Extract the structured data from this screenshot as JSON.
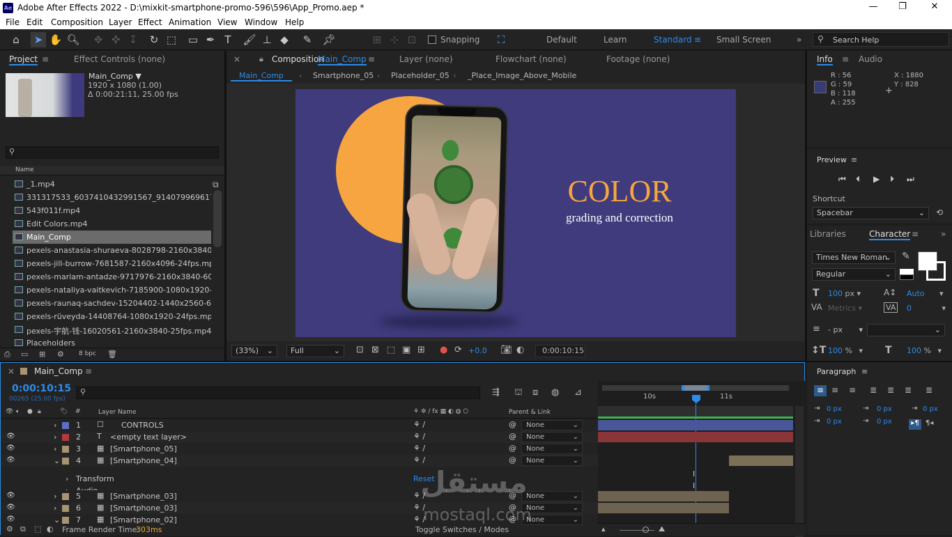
{
  "window": {
    "title": "Adobe After Effects 2022 - D:\\mixkit-smartphone-promo-596\\596\\App_Promo.aep *",
    "app_icon": "Ae"
  },
  "menu": [
    "File",
    "Edit",
    "Composition",
    "Layer",
    "Effect",
    "Animation",
    "View",
    "Window",
    "Help"
  ],
  "toolbar": {
    "snapping": "Snapping",
    "workspaces": [
      "Default",
      "Learn",
      "Standard",
      "Small Screen"
    ],
    "active_workspace": "Standard",
    "search_help": "Search Help",
    "more": "»"
  },
  "project": {
    "tab": "Project",
    "effect_controls": "Effect Controls (none)",
    "comp_name": "Main_Comp ▼",
    "comp_size": "1920 x 1080 (1.00)",
    "comp_duration": "Δ 0:00:21:11, 25.00 fps",
    "col_name": "Name",
    "items": [
      "_1.mp4",
      "331317533_6037410432991567_91407996961760752",
      "543f011f.mp4",
      "Edit Colors.mp4",
      "Main_Comp",
      "pexels-anastasia-shuraeva-8028798-2160x3840-24fps",
      "pexels-jill-burrow-7681587-2160x4096-24fps.mp4",
      "pexels-mariam-antadze-9717976-2160x3840-60fps.mp",
      "pexels-nataliya-vaitkevich-7185900-1080x1920-30fps.",
      "pexels-raunaq-sachdev-15204402-1440x2560-60fps.m",
      "pexels-rüveyda-14408764-1080x1920-24fps.mp4",
      "pexels-宇航-钱-16020561-2160x3840-25fps.mp4",
      "Placeholders"
    ],
    "selected_index": 4,
    "bpc": "8 bpc"
  },
  "composition": {
    "close": "×",
    "tab_prefix": "Composition",
    "tab_name": "Main_Comp",
    "layer_tab": "Layer (none)",
    "flowchart_tab": "Flowchart (none)",
    "footage_tab": "Footage (none)",
    "breadcrumbs": [
      "Main_Comp",
      "Smartphone_05",
      "Placeholder_05",
      "_Place_Image_Above_Mobile"
    ],
    "zoom": "(33%)",
    "resolution": "Full",
    "exposure": "+0.0",
    "timecode": "0:00:10:15",
    "headline": "COLOR",
    "subline": "grading and correction",
    "bg_color": "#3f3b7c",
    "circle_color": "#f7a540"
  },
  "info": {
    "tab": "Info",
    "audio": "Audio",
    "r": "R : 56",
    "g": "G : 59",
    "b": "B : 118",
    "a": "A : 255",
    "x": "X : 1880",
    "y": "Y : 828",
    "swatch": "#383b76"
  },
  "preview": {
    "title": "Preview",
    "shortcut_label": "Shortcut",
    "shortcut": "Spacebar"
  },
  "character": {
    "libraries": "Libraries",
    "tab": "Character",
    "font": "Times New Roman",
    "style": "Regular",
    "size": "100",
    "size_unit": "px",
    "leading": "Auto",
    "kerning": "Metrics",
    "tracking": "0",
    "stroke": "-",
    "stroke_unit": "px",
    "vscale": "100",
    "vscale_unit": "%",
    "hscale": "100",
    "hscale_unit": "%"
  },
  "paragraph": {
    "tab": "Paragraph",
    "values": [
      "0 px",
      "0 px",
      "0 px",
      "0 px",
      "0 px"
    ]
  },
  "timeline": {
    "close": "×",
    "tab": "Main_Comp",
    "timecode": "0:00:10:15",
    "frames": "00265 (25.00 fps)",
    "col_layer": "Layer Name",
    "col_parent": "Parent & Link",
    "ruler": [
      "10s",
      "11s"
    ],
    "layers": [
      {
        "num": "1",
        "name": "CONTROLS",
        "color": "#5b6fc7",
        "type": "null",
        "parent": "None",
        "bar": "#4a569a"
      },
      {
        "num": "2",
        "name": "<empty text layer>",
        "color": "#b33a3a",
        "type": "text",
        "parent": "None",
        "bar": "#8a3537"
      },
      {
        "num": "3",
        "name": "[Smartphone_05]",
        "color": "#a89372",
        "type": "comp",
        "parent": "None",
        "bar": ""
      },
      {
        "num": "4",
        "name": "[Smartphone_04]",
        "color": "#a89372",
        "type": "comp",
        "parent": "None",
        "bar": "#7c6f58"
      },
      {
        "num": "5",
        "name": "[Smartphone_03]",
        "color": "#a89372",
        "type": "comp",
        "parent": "None",
        "bar": "#6e6350"
      },
      {
        "num": "6",
        "name": "[Smartphone_03]",
        "color": "#a89372",
        "type": "comp",
        "parent": "None",
        "bar": "#6e6350"
      },
      {
        "num": "7",
        "name": "[Smartphone_02]",
        "color": "#a89372",
        "type": "comp",
        "parent": "None",
        "bar": ""
      }
    ],
    "transform": "Transform",
    "reset": "Reset",
    "audio": "Audio",
    "frame_render": "Frame Render Time:",
    "render_ms": "303ms",
    "toggle": "Toggle Switches / Modes"
  },
  "watermark": {
    "arabic": "مستقل",
    "latin": "mostaql.com"
  }
}
